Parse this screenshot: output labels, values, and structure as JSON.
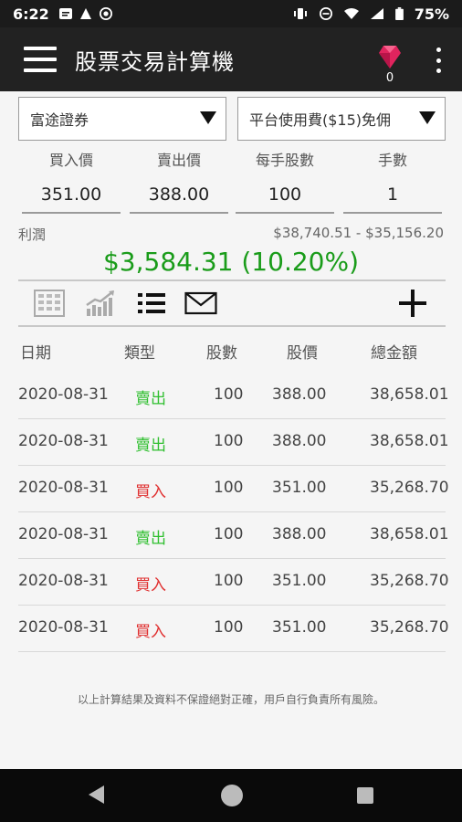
{
  "status": {
    "time": "6:22",
    "battery": "75%"
  },
  "appbar": {
    "title": "股票交易計算機",
    "gem_count": "0"
  },
  "selects": {
    "broker": "富途證券",
    "fee_plan": "平台使用費($15)免佣"
  },
  "fields": {
    "buy_price": {
      "label": "買入價",
      "value": "351.00"
    },
    "sell_price": {
      "label": "賣出價",
      "value": "388.00"
    },
    "lot_size": {
      "label": "每手股數",
      "value": "100"
    },
    "lots": {
      "label": "手數",
      "value": "1"
    }
  },
  "profit": {
    "label": "利潤",
    "range": "$38,740.51 - $35,156.20",
    "value": "$3,584.31 (10.20%)"
  },
  "toolbar": {
    "icons": [
      "calculator-icon",
      "chart-icon",
      "list-icon",
      "mail-icon",
      "add-icon"
    ]
  },
  "table": {
    "headers": [
      "日期",
      "類型",
      "股數",
      "股價",
      "總金額"
    ],
    "rows": [
      {
        "date": "2020-08-31",
        "type": "賣出",
        "kind": "sell",
        "qty": "100",
        "price": "388.00",
        "total": "38,658.01"
      },
      {
        "date": "2020-08-31",
        "type": "賣出",
        "kind": "sell",
        "qty": "100",
        "price": "388.00",
        "total": "38,658.01"
      },
      {
        "date": "2020-08-31",
        "type": "買入",
        "kind": "buy",
        "qty": "100",
        "price": "351.00",
        "total": "35,268.70"
      },
      {
        "date": "2020-08-31",
        "type": "賣出",
        "kind": "sell",
        "qty": "100",
        "price": "388.00",
        "total": "38,658.01"
      },
      {
        "date": "2020-08-31",
        "type": "買入",
        "kind": "buy",
        "qty": "100",
        "price": "351.00",
        "total": "35,268.70"
      },
      {
        "date": "2020-08-31",
        "type": "買入",
        "kind": "buy",
        "qty": "100",
        "price": "351.00",
        "total": "35,268.70"
      }
    ]
  },
  "disclaimer": "以上計算結果及資料不保證絕對正確，用戶自行負責所有風險。",
  "colors": {
    "profit": "#1a9c1a",
    "sell": "#2fbf2f",
    "buy": "#e03030",
    "appbar": "#222222"
  }
}
